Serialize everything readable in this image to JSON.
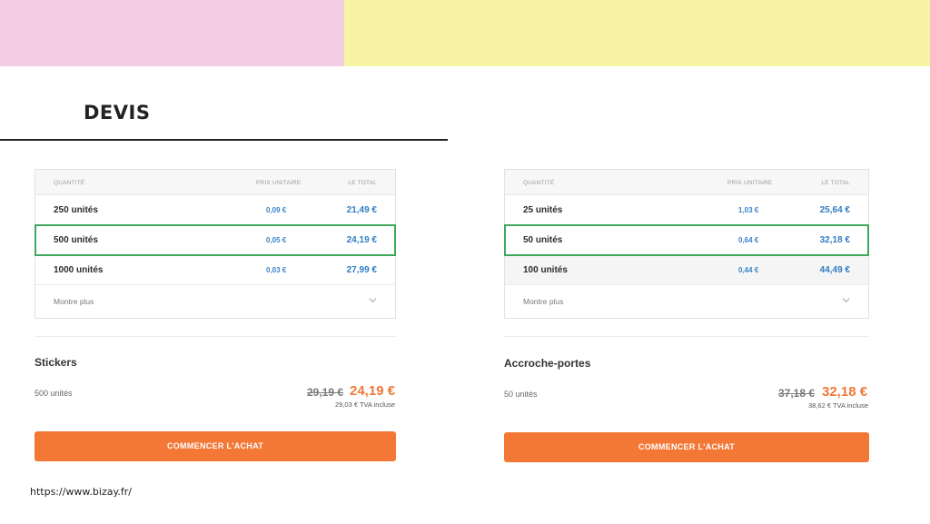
{
  "page": {
    "title": "DEVIS",
    "source_url": "https://www.bizay.fr/"
  },
  "colors": {
    "band_pink": "#f2cde3",
    "band_yellow": "#f7f5a4",
    "accent_orange": "#f37735",
    "price_blue": "#2f7cc4",
    "selected_green": "#3ea95a"
  },
  "quotes": [
    {
      "table": {
        "headers": {
          "quantity": "QUANTITÉ",
          "unit_price": "PRIX UNITAIRE",
          "total": "LE TOTAL"
        },
        "rows": [
          {
            "quantity": "250 unités",
            "unit_price": "0,09 €",
            "total": "21,49 €"
          },
          {
            "quantity": "500 unités",
            "unit_price": "0,05 €",
            "total": "24,19 €",
            "selected": true
          },
          {
            "quantity": "1000 unités",
            "unit_price": "0,03 €",
            "total": "27,99 €"
          }
        ],
        "show_more_label": "Montre plus"
      },
      "product": {
        "name": "Stickers",
        "quantity": "500 unités",
        "old_price": "29,19 €",
        "new_price": "24,19 €",
        "tva_note": "29,03 € TVA incluse"
      },
      "cta_label": "COMMENCER L'ACHAT"
    },
    {
      "table": {
        "headers": {
          "quantity": "QUANTITÉ",
          "unit_price": "PRIX UNITAIRE",
          "total": "LE TOTAL"
        },
        "rows": [
          {
            "quantity": "25 unités",
            "unit_price": "1,03 €",
            "total": "25,64 €"
          },
          {
            "quantity": "50 unités",
            "unit_price": "0,64 €",
            "total": "32,18 €",
            "selected": true
          },
          {
            "quantity": "100 unités",
            "unit_price": "0,44 €",
            "total": "44,49 €"
          }
        ],
        "show_more_label": "Montre plus"
      },
      "product": {
        "name": "Accroche-portes",
        "quantity": "50 unités",
        "old_price": "37,18 €",
        "new_price": "32,18 €",
        "tva_note": "38,62 € TVA incluse"
      },
      "cta_label": "COMMENCER L'ACHAT"
    }
  ]
}
